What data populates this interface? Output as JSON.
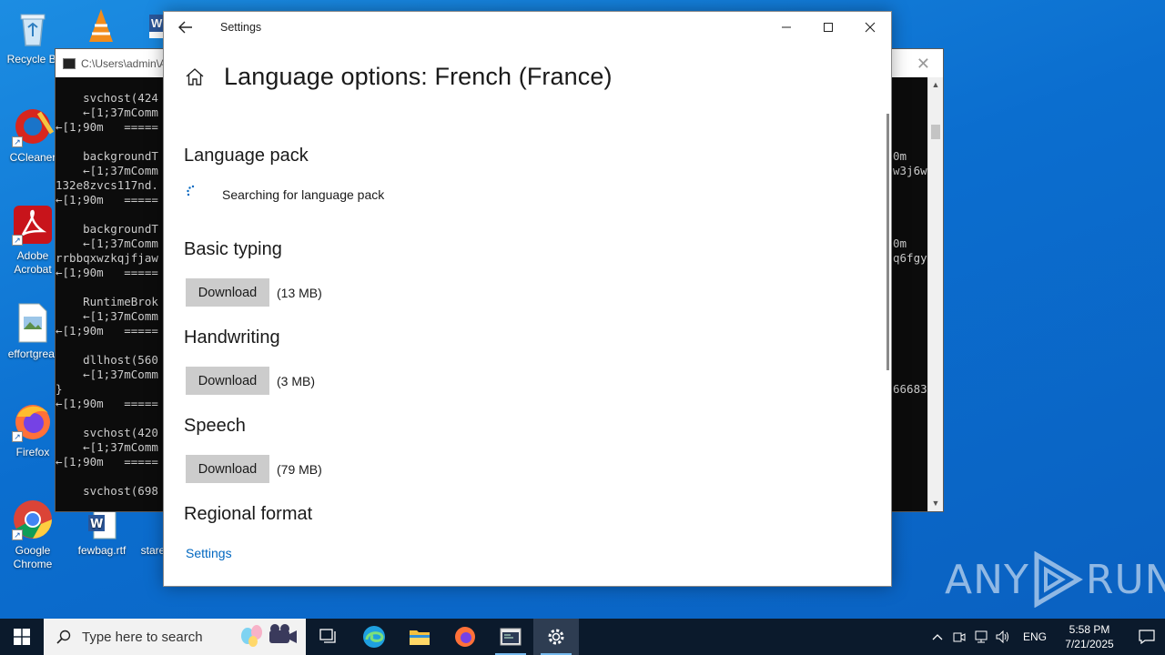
{
  "desktop": {
    "icons": [
      {
        "label": "Recycle Bi"
      },
      {
        "label": "CCleaner"
      },
      {
        "label": "Adobe Acrobat"
      },
      {
        "label": "effortgreat"
      },
      {
        "label": "Firefox"
      },
      {
        "label": "Google Chrome"
      },
      {
        "label": "fewbag.rtf"
      },
      {
        "label": "stare"
      }
    ]
  },
  "console": {
    "title": "C:\\Users\\admin\\A",
    "lines_left": "    svchost(424\n    ←[1;37mComm\n←[1;90m   =====\n\n    backgroundT\n    ←[1;37mComm\n132e8zvcs117nd.\n←[1;90m   =====\n\n    backgroundT\n    ←[1;37mComm\nrrbbqxwzkqjfjaw\n←[1;90m   =====\n\n    RuntimeBrok\n    ←[1;37mComm\n←[1;90m   =====\n\n    dllhost(560\n    ←[1;37mComm\n}\n←[1;90m   =====\n\n    svchost(420\n    ←[1;37mComm\n←[1;90m   =====\n\n    svchost(698",
    "lines_right": "0m\nw3j6w\n\n\n\n\n0m\nq6fgy\n\n\n\n\n\n\n\n\n66683"
  },
  "settings": {
    "window_title": "Settings",
    "page_title": "Language options: French (France)",
    "language_pack": {
      "title": "Language pack",
      "status": "Searching for language pack"
    },
    "sections": [
      {
        "title": "Basic typing",
        "button": "Download",
        "size": "(13 MB)"
      },
      {
        "title": "Handwriting",
        "button": "Download",
        "size": "(3 MB)"
      },
      {
        "title": "Speech",
        "button": "Download",
        "size": "(79 MB)"
      }
    ],
    "regional": {
      "title": "Regional format",
      "link": "Settings"
    }
  },
  "watermark": {
    "left": "ANY",
    "right": "RUN"
  },
  "taskbar": {
    "search_placeholder": "Type here to search",
    "language": "ENG",
    "time": "5:58 PM",
    "date": "7/21/2025"
  },
  "colors": {
    "link": "#0067c0",
    "button": "#cccccc",
    "taskbar": "#0b1a2c",
    "desktop": "#0b6ecf"
  }
}
